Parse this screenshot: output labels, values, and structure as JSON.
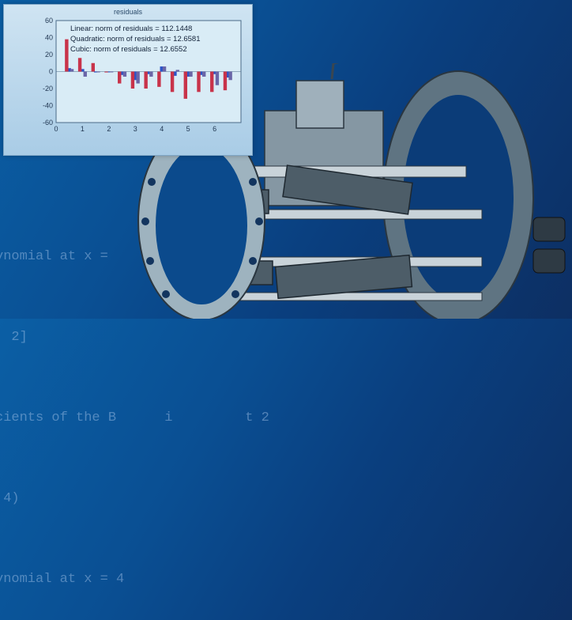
{
  "code_lines": [
    "ynomial at x = ",
    "  2]",
    "cients of the B      i         t 2",
    ",4)",
    "ynomial at x = 4"
  ],
  "plot": {
    "title": "residuals",
    "legend": [
      "Linear: norm of residuals = 112.1448",
      "Quadratic: norm of residuals = 12.6581",
      "Cubic: norm of residuals = 12.6552"
    ],
    "colors": {
      "linear": "#2b54c8",
      "quadratic": "#c8334a",
      "cubic": "#6a66a8"
    }
  },
  "chart_data": {
    "type": "bar",
    "title": "residuals",
    "xlim": [
      0,
      7
    ],
    "ylim": [
      -60,
      60
    ],
    "x_ticks": [
      0,
      1,
      2,
      3,
      4,
      5,
      6
    ],
    "y_ticks": [
      60,
      40,
      20,
      0,
      -20,
      -40,
      -60
    ],
    "series": [
      {
        "name": "Linear",
        "x": [
          0.5,
          1.0,
          1.5,
          2.0,
          2.5,
          3.0,
          3.5,
          4.0,
          4.5,
          5.0,
          5.5,
          6.0,
          6.5
        ],
        "values": [
          4,
          3,
          -1,
          0,
          -4,
          -10,
          -3,
          6,
          -5,
          -6,
          -4,
          -3,
          -7
        ]
      },
      {
        "name": "Quadratic",
        "x": [
          0.4,
          0.9,
          1.4,
          1.9,
          2.4,
          2.9,
          3.4,
          3.9,
          4.4,
          4.9,
          5.4,
          5.9,
          6.4
        ],
        "values": [
          38,
          16,
          10,
          -1,
          -14,
          -20,
          -20,
          -18,
          -24,
          -32,
          -24,
          -24,
          -22
        ]
      },
      {
        "name": "Cubic",
        "x": [
          0.6,
          1.1,
          1.6,
          2.1,
          2.6,
          3.1,
          3.6,
          4.1,
          4.6,
          5.1,
          5.6,
          6.1,
          6.6
        ],
        "values": [
          3,
          -6,
          0,
          0,
          -6,
          -14,
          -6,
          6,
          2,
          -6,
          -6,
          -16,
          -10
        ]
      }
    ]
  }
}
